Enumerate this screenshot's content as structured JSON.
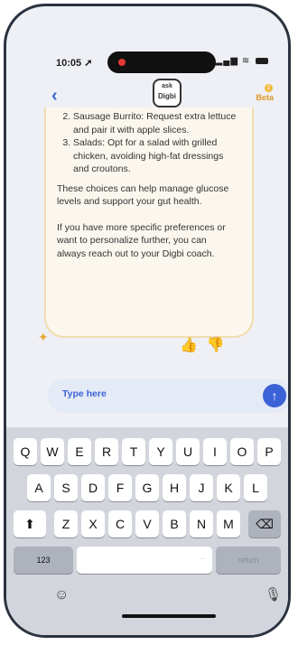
{
  "status_bar": {
    "time": "10:05 ➚",
    "signal": "▂▄▆",
    "wifi": "≋"
  },
  "header": {
    "back": "‹",
    "logo_line1": "ask",
    "logo_line2": "Digbi",
    "beta_label": "Beta",
    "beta_count": "1"
  },
  "message": {
    "list_items": [
      "Sausage Burrito: Request extra lettuce and pair it with apple slices.",
      "Salads: Opt for a salad with grilled chicken, avoiding high-fat dressings and croutons."
    ],
    "list_start": 2,
    "paragraph1": "These choices can help manage glucose levels and support your gut health.",
    "paragraph2": "If you have more specific preferences or want to personalize further, you can always reach out to your Digbi coach."
  },
  "feedback": {
    "up_icon": "thumbs-up-icon",
    "down_icon": "thumbs-down-icon"
  },
  "input": {
    "placeholder": "Type here"
  },
  "keyboard": {
    "row1": [
      "Q",
      "W",
      "E",
      "R",
      "T",
      "Y",
      "U",
      "I",
      "O",
      "P"
    ],
    "row2": [
      "A",
      "S",
      "D",
      "F",
      "G",
      "H",
      "J",
      "K",
      "L"
    ],
    "row3": [
      "Z",
      "X",
      "C",
      "V",
      "B",
      "N",
      "M"
    ],
    "shift": "⬆",
    "backspace": "⌫",
    "numbers": "123",
    "return": "return",
    "space_hint": "..."
  },
  "colors": {
    "accent": "#3b62d6",
    "bubble_bg": "#fbf7ef",
    "bubble_border": "#f1dcae",
    "beta": "#e0962a"
  }
}
